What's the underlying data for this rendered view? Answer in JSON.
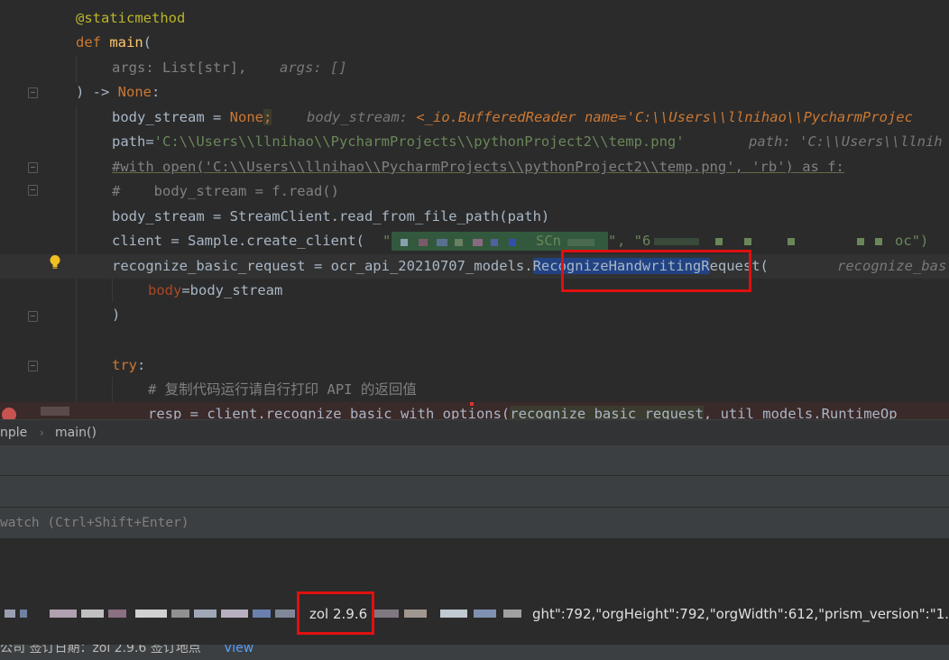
{
  "editor": {
    "lines": {
      "l1": "@staticmethod",
      "l2_kw": "def",
      "l2_fn": "main",
      "l2_rest": "(",
      "l3_arg": "args: List[str],",
      "l3_hint": "args: []",
      "l4_a": ") -> ",
      "l4_b": "None",
      "l4_c": ":",
      "l5_a": "body_stream = ",
      "l5_b": "None",
      "l5_c": ";",
      "l5_hint_a": "body_stream: ",
      "l5_hint_b": "<_io.BufferedReader name='C:\\\\Users\\\\llnihao\\\\PycharmProjec",
      "l6_a": "path",
      "l6_b": "=",
      "l6_c": "'C:\\\\Users\\\\llnihao\\\\PycharmProjects\\\\pythonProject2\\\\temp.png'",
      "l6_hint": "path: 'C:\\\\Users\\\\llnih",
      "l7": "#with open('C:\\\\Users\\\\llnihao\\\\PycharmProjects\\\\pythonProject2\\\\temp.png', 'rb') as f:",
      "l8": "#    body_stream = f.read()",
      "l9": "body_stream = StreamClient.read_from_file_path(path)",
      "l10_a": "client = Sample.create_client(",
      "l10_b": "\"",
      "l10_c": "SCn",
      "l10_d": "\"",
      "l10_e": ", \"6",
      "l10_f": "oc\")",
      "l11_a": "recognize_basic_request = ocr_api_20210707_models.",
      "l11_b": "RecognizeHandwritingR",
      "l11_c": "equest(",
      "l11_hint": "recognize_bas",
      "l12_a": "body",
      "l12_b": "=body_stream",
      "l13": ")",
      "l15_a": "try",
      "l15_b": ":",
      "l16": "# 复制代码运行请自行打印 API 的返回值",
      "l17_a": "resp = client.recognize_basic_with_options(",
      "l17_b": "recognize_basic_request",
      "l17_c": ", util_models.RuntimeOp"
    }
  },
  "breadcrumbs": {
    "item1": "nple",
    "item2": "main()"
  },
  "debug": {
    "watch_placeholder": "watch (Ctrl+Shift+Enter)",
    "version_box": "zol 2.9.6",
    "json_tail": "ght\":792,\"orgHeight\":792,\"orgWidth\":612,\"prism_version\":\"1.0.",
    "status_text": "公司 签订日期：zol 2.9.6 签订地点",
    "status_link": "View"
  },
  "colors": {
    "editor_bg": "#2b2b2b",
    "keyword": "#cc7832",
    "string": "#6a8759",
    "highlight_box": "#e01010"
  }
}
